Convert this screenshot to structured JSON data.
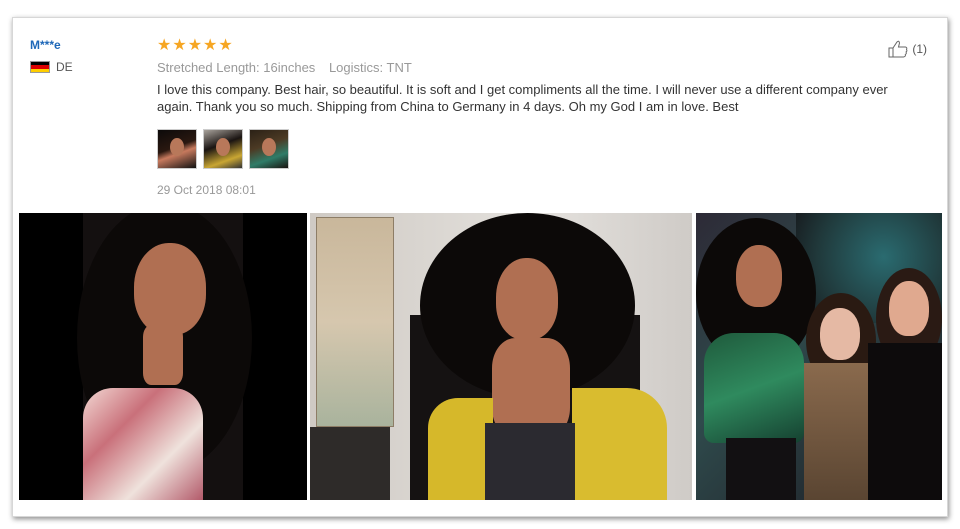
{
  "review": {
    "reviewer_name": "M***e",
    "country_code": "DE",
    "rating": 5,
    "stars": [
      "★",
      "★",
      "★",
      "★",
      "★"
    ],
    "stretched_length_label": "Stretched Length:",
    "stretched_length_value": "16inches",
    "logistics_label": "Logistics:",
    "logistics_value": "TNT",
    "text": "I love this company. Best hair, so beautiful. It is soft and I get compliments all the time. I will never use a different company ever again. Thank you so much. Shipping from China to Germany in 4 days. Oh my God I am in love. Best",
    "date": "29 Oct 2018 08:01",
    "helpful_count": "(1)"
  },
  "icons": {
    "like": "thumbs-up-icon",
    "flag": "germany-flag-icon"
  },
  "colors": {
    "reviewer_name": "#1d67b8",
    "star": "#f6a623",
    "meta_text": "#999999",
    "body_text": "#333333"
  }
}
